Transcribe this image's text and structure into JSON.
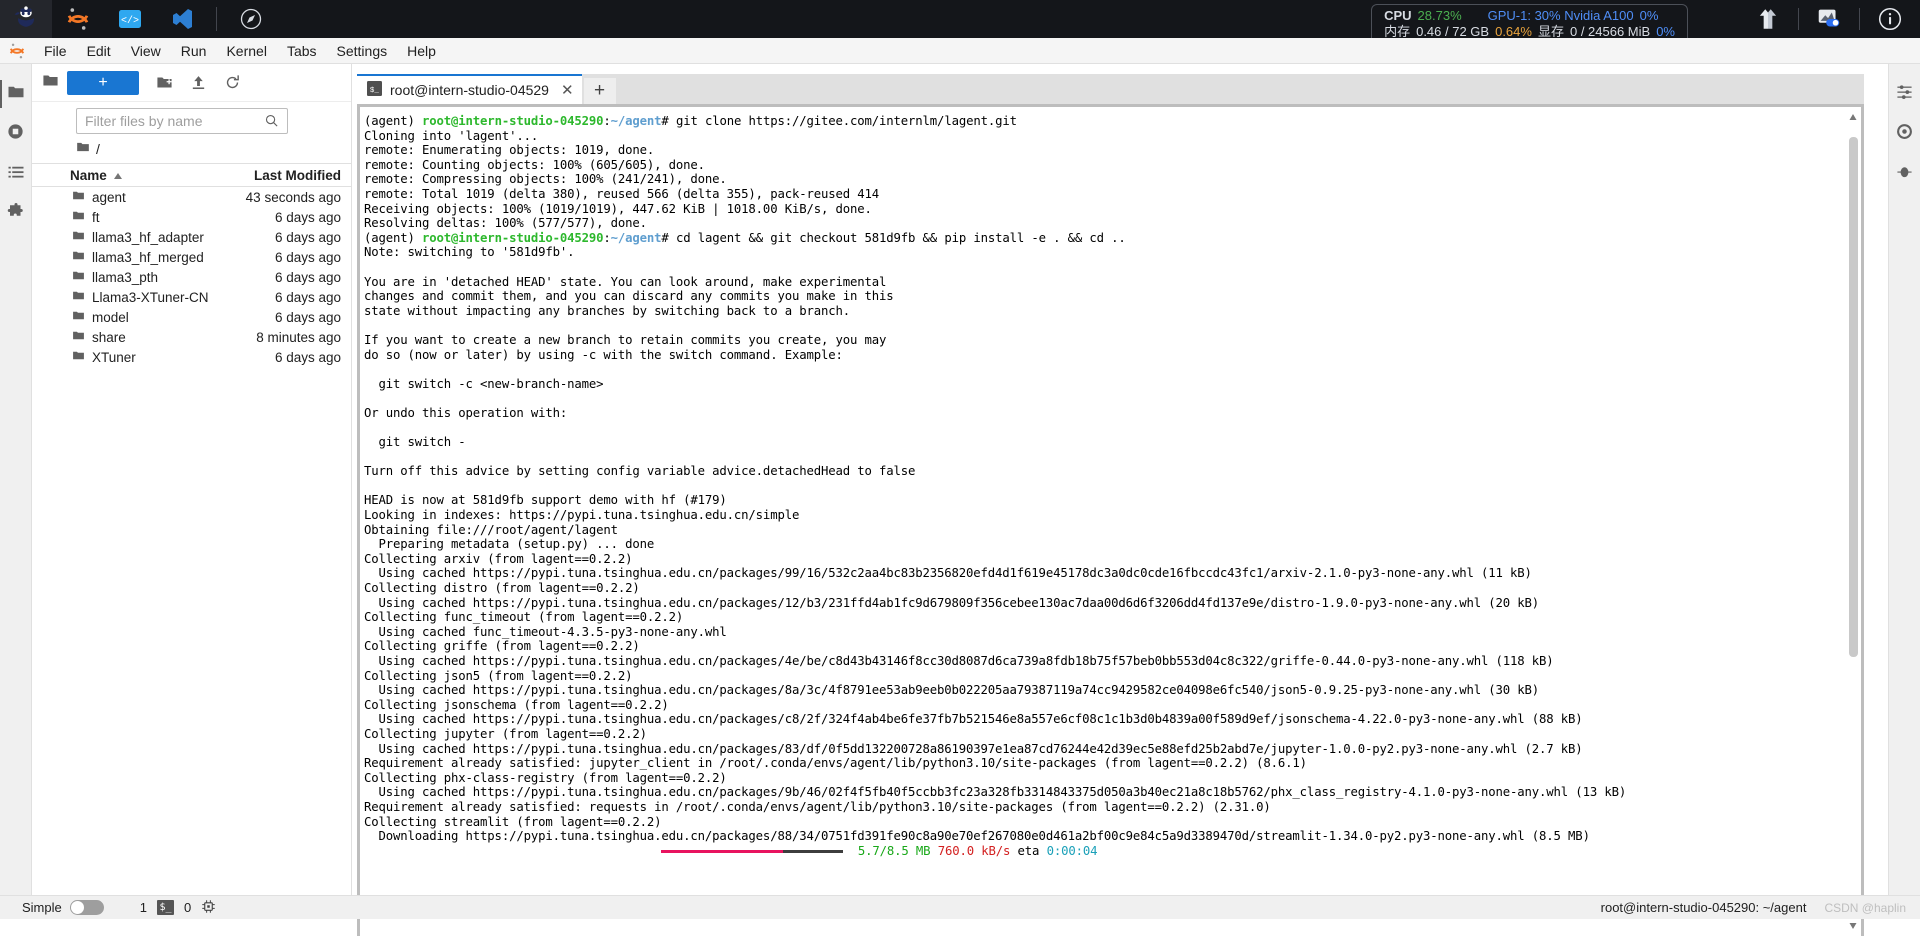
{
  "topbar": {
    "apps": [
      {
        "name": "intern-studio-logo",
        "title": "InternStudio"
      },
      {
        "name": "jupyter-logo",
        "title": "Jupyter"
      },
      {
        "name": "code-server-logo",
        "title": "Code Server"
      },
      {
        "name": "vscode-logo",
        "title": "VS Code"
      },
      {
        "name": "compass-logo",
        "title": "Browser"
      }
    ],
    "sysmon": {
      "cpu_label": "CPU",
      "cpu_value": "28.73%",
      "gpu_label": "GPU-1: 30% Nvidia A100",
      "gpu_value": "0%",
      "mem_label": "内存",
      "mem_value": "0.46 / 72 GB",
      "mem_pct": "0.64%",
      "vram_label": "显存",
      "vram_value": "0 / 24566 MiB",
      "vram_pct": "0%"
    },
    "right_icons": [
      {
        "name": "upload-arrows-icon"
      },
      {
        "name": "image-toggle-icon"
      },
      {
        "name": "info-icon"
      }
    ]
  },
  "menubar": {
    "items": [
      "File",
      "Edit",
      "View",
      "Run",
      "Kernel",
      "Tabs",
      "Settings",
      "Help"
    ]
  },
  "rail": {
    "items": [
      {
        "name": "sidebar-item-file-browser",
        "icon": "folder-icon",
        "active": true
      },
      {
        "name": "sidebar-item-running",
        "icon": "stop-circle-icon",
        "active": false
      },
      {
        "name": "sidebar-item-commands",
        "icon": "list-icon",
        "active": false
      },
      {
        "name": "sidebar-item-extensions",
        "icon": "puzzle-icon",
        "active": false
      }
    ]
  },
  "right_rail": {
    "items": [
      {
        "name": "sidebar-item-property-inspector",
        "icon": "sliders-icon"
      },
      {
        "name": "sidebar-item-settings",
        "icon": "gear-icon"
      },
      {
        "name": "sidebar-item-debugger",
        "icon": "bug-icon"
      }
    ]
  },
  "filebrowser": {
    "new_label": "+",
    "toolbar_icons": [
      {
        "name": "new-folder-icon"
      },
      {
        "name": "upload-icon"
      },
      {
        "name": "refresh-icon"
      }
    ],
    "filter_placeholder": "Filter files by name",
    "filter_value": "",
    "breadcrumb": "/",
    "columns": {
      "name": "Name",
      "modified": "Last Modified"
    },
    "rows": [
      {
        "name": "agent",
        "modified": "43 seconds ago"
      },
      {
        "name": "ft",
        "modified": "6 days ago"
      },
      {
        "name": "llama3_hf_adapter",
        "modified": "6 days ago"
      },
      {
        "name": "llama3_hf_merged",
        "modified": "6 days ago"
      },
      {
        "name": "llama3_pth",
        "modified": "6 days ago"
      },
      {
        "name": "Llama3-XTuner-CN",
        "modified": "6 days ago"
      },
      {
        "name": "model",
        "modified": "6 days ago"
      },
      {
        "name": "share",
        "modified": "8 minutes ago"
      },
      {
        "name": "XTuner",
        "modified": "6 days ago"
      }
    ]
  },
  "tabs": {
    "active_tab_label": "root@intern-studio-04529",
    "tab_icon": "terminal-icon",
    "close_label": "✕",
    "add_label": "+"
  },
  "terminal": {
    "prompt": {
      "env": "(agent)",
      "user_host": "root@intern-studio-045290",
      "colon": ":",
      "path": "~/agent",
      "hash": "#"
    },
    "lines": [
      {
        "type": "prompt",
        "cmd": " git clone https://gitee.com/internlm/lagent.git"
      },
      {
        "type": "plain",
        "text": "Cloning into 'lagent'..."
      },
      {
        "type": "plain",
        "text": "remote: Enumerating objects: 1019, done."
      },
      {
        "type": "plain",
        "text": "remote: Counting objects: 100% (605/605), done."
      },
      {
        "type": "plain",
        "text": "remote: Compressing objects: 100% (241/241), done."
      },
      {
        "type": "plain",
        "text": "remote: Total 1019 (delta 380), reused 566 (delta 355), pack-reused 414"
      },
      {
        "type": "plain",
        "text": "Receiving objects: 100% (1019/1019), 447.62 KiB | 1018.00 KiB/s, done."
      },
      {
        "type": "plain",
        "text": "Resolving deltas: 100% (577/577), done."
      },
      {
        "type": "prompt",
        "cmd": " cd lagent && git checkout 581d9fb && pip install -e . && cd .."
      },
      {
        "type": "plain",
        "text": "Note: switching to '581d9fb'."
      },
      {
        "type": "plain",
        "text": ""
      },
      {
        "type": "plain",
        "text": "You are in 'detached HEAD' state. You can look around, make experimental"
      },
      {
        "type": "plain",
        "text": "changes and commit them, and you can discard any commits you make in this"
      },
      {
        "type": "plain",
        "text": "state without impacting any branches by switching back to a branch."
      },
      {
        "type": "plain",
        "text": ""
      },
      {
        "type": "plain",
        "text": "If you want to create a new branch to retain commits you create, you may"
      },
      {
        "type": "plain",
        "text": "do so (now or later) by using -c with the switch command. Example:"
      },
      {
        "type": "plain",
        "text": ""
      },
      {
        "type": "plain",
        "text": "  git switch -c <new-branch-name>"
      },
      {
        "type": "plain",
        "text": ""
      },
      {
        "type": "plain",
        "text": "Or undo this operation with:"
      },
      {
        "type": "plain",
        "text": ""
      },
      {
        "type": "plain",
        "text": "  git switch -"
      },
      {
        "type": "plain",
        "text": ""
      },
      {
        "type": "plain",
        "text": "Turn off this advice by setting config variable advice.detachedHead to false"
      },
      {
        "type": "plain",
        "text": ""
      },
      {
        "type": "plain",
        "text": "HEAD is now at 581d9fb support demo with hf (#179)"
      },
      {
        "type": "plain",
        "text": "Looking in indexes: https://pypi.tuna.tsinghua.edu.cn/simple"
      },
      {
        "type": "plain",
        "text": "Obtaining file:///root/agent/lagent"
      },
      {
        "type": "plain",
        "text": "  Preparing metadata (setup.py) ... done"
      },
      {
        "type": "plain",
        "text": "Collecting arxiv (from lagent==0.2.2)"
      },
      {
        "type": "plain",
        "text": "  Using cached https://pypi.tuna.tsinghua.edu.cn/packages/99/16/532c2aa4bc83b2356820efd4d1f619e45178dc3a0dc0cde16fbccdc43fc1/arxiv-2.1.0-py3-none-any.whl (11 kB)"
      },
      {
        "type": "plain",
        "text": "Collecting distro (from lagent==0.2.2)"
      },
      {
        "type": "plain",
        "text": "  Using cached https://pypi.tuna.tsinghua.edu.cn/packages/12/b3/231ffd4ab1fc9d679809f356cebee130ac7daa00d6d6f3206dd4fd137e9e/distro-1.9.0-py3-none-any.whl (20 kB)"
      },
      {
        "type": "plain",
        "text": "Collecting func_timeout (from lagent==0.2.2)"
      },
      {
        "type": "plain",
        "text": "  Using cached func_timeout-4.3.5-py3-none-any.whl"
      },
      {
        "type": "plain",
        "text": "Collecting griffe (from lagent==0.2.2)"
      },
      {
        "type": "plain",
        "text": "  Using cached https://pypi.tuna.tsinghua.edu.cn/packages/4e/be/c8d43b43146f8cc30d8087d6ca739a8fdb18b75f57beb0bb553d04c8c322/griffe-0.44.0-py3-none-any.whl (118 kB)"
      },
      {
        "type": "plain",
        "text": "Collecting json5 (from lagent==0.2.2)"
      },
      {
        "type": "plain",
        "text": "  Using cached https://pypi.tuna.tsinghua.edu.cn/packages/8a/3c/4f8791ee53ab9eeb0b022205aa79387119a74cc9429582ce04098e6fc540/json5-0.9.25-py3-none-any.whl (30 kB)"
      },
      {
        "type": "plain",
        "text": "Collecting jsonschema (from lagent==0.2.2)"
      },
      {
        "type": "plain",
        "text": "  Using cached https://pypi.tuna.tsinghua.edu.cn/packages/c8/2f/324f4ab4be6fe37fb7b521546e8a557e6cf08c1c1b3d0b4839a00f589d9ef/jsonschema-4.22.0-py3-none-any.whl (88 kB)"
      },
      {
        "type": "plain",
        "text": "Collecting jupyter (from lagent==0.2.2)"
      },
      {
        "type": "plain",
        "text": "  Using cached https://pypi.tuna.tsinghua.edu.cn/packages/83/df/0f5dd132200728a86190397e1ea87cd76244e42d39ec5e88efd25b2abd7e/jupyter-1.0.0-py2.py3-none-any.whl (2.7 kB)"
      },
      {
        "type": "plain",
        "text": "Requirement already satisfied: jupyter_client in /root/.conda/envs/agent/lib/python3.10/site-packages (from lagent==0.2.2) (8.6.1)"
      },
      {
        "type": "plain",
        "text": "Collecting phx-class-registry (from lagent==0.2.2)"
      },
      {
        "type": "plain",
        "text": "  Using cached https://pypi.tuna.tsinghua.edu.cn/packages/9b/46/02f4f5fb40f5ccbb3fc23a328fb3314843375d050a3b40ec21a8c18b5762/phx_class_registry-4.1.0-py3-none-any.whl (13 kB)"
      },
      {
        "type": "plain",
        "text": "Requirement already satisfied: requests in /root/.conda/envs/agent/lib/python3.10/site-packages (from lagent==0.2.2) (2.31.0)"
      },
      {
        "type": "plain",
        "text": "Collecting streamlit (from lagent==0.2.2)"
      },
      {
        "type": "plain",
        "text": "  Downloading https://pypi.tuna.tsinghua.edu.cn/packages/88/34/0751fd391fe90c8a90e70ef267080e0d461a2bf00c9e84c5a9d3389470d/streamlit-1.34.0-py2.py3-none-any.whl (8.5 MB)"
      }
    ],
    "progress": {
      "downloaded": "5.7/8.5 MB",
      "speed": "760.0 kB/s",
      "eta_label": "eta",
      "eta_value": "0:00:04",
      "percent": 67
    }
  },
  "statusbar": {
    "mode_label": "Simple",
    "mode_on": false,
    "kernel_count": "1",
    "terminal_icon": "terminal-icon",
    "terminal_count": "0",
    "cpu_icon": "chip-icon",
    "right_text": "root@intern-studio-045290: ~/agent",
    "watermark": "CSDN @haplin"
  }
}
